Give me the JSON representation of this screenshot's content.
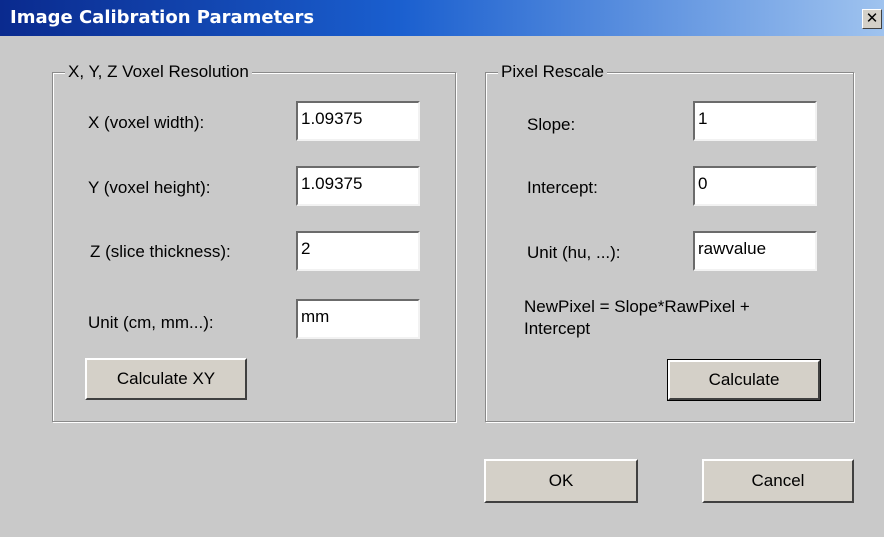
{
  "dialog": {
    "title": "Image Calibration Parameters",
    "close_label": "✕"
  },
  "voxel": {
    "group_title": "X, Y, Z Voxel Resolution",
    "x_label": "X (voxel width):",
    "x_value": "1.09375",
    "y_label": "Y (voxel height):",
    "y_value": "1.09375",
    "z_label": "Z (slice thickness):",
    "z_value": "2",
    "unit_label": "Unit (cm, mm...):",
    "unit_value": "mm",
    "calc_button": "Calculate XY"
  },
  "rescale": {
    "group_title": "Pixel Rescale",
    "slope_label": "Slope:",
    "slope_value": "1",
    "intercept_label": "Intercept:",
    "intercept_value": "0",
    "unit_label": "Unit (hu, ...):",
    "unit_value": "rawvalue",
    "formula_line1": "NewPixel = Slope*RawPixel +",
    "formula_line2": "Intercept",
    "calc_button": "Calculate"
  },
  "footer": {
    "ok_label": "OK",
    "cancel_label": "Cancel"
  }
}
